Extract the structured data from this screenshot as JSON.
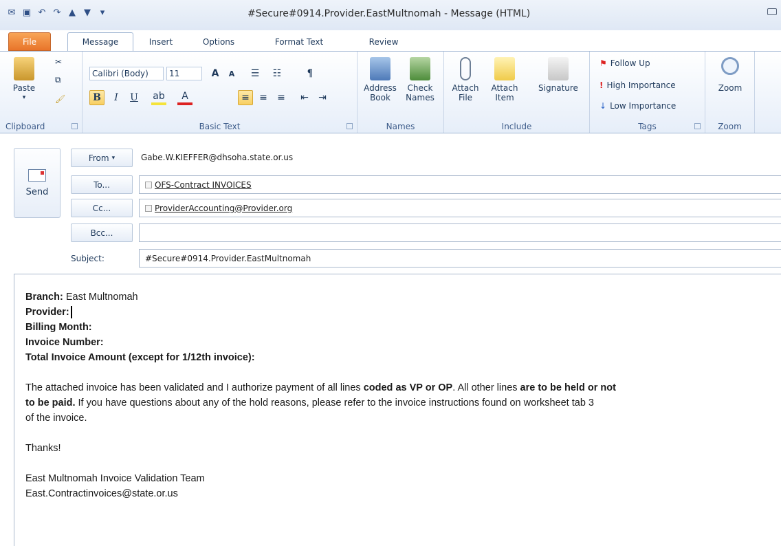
{
  "window": {
    "title": "#Secure#0914.Provider.EastMultnomah - Message (HTML)"
  },
  "tabs": [
    "File",
    "Message",
    "Insert",
    "Options",
    "Format Text",
    "Review"
  ],
  "ribbon": {
    "clipboard": {
      "label": "Clipboard",
      "paste": "Paste"
    },
    "basic_text": {
      "label": "Basic Text",
      "font_name": "Calibri (Body)",
      "font_size": "11"
    },
    "names": {
      "label": "Names",
      "address_book": "Address Book",
      "check_names": "Check Names"
    },
    "include": {
      "label": "Include",
      "attach_file": "Attach File",
      "attach_item": "Attach Item",
      "signature": "Signature"
    },
    "tags": {
      "label": "Tags",
      "follow_up": "Follow Up",
      "high_importance": "High Importance",
      "low_importance": "Low Importance"
    },
    "zoom": {
      "label": "Zoom",
      "zoom": "Zoom"
    }
  },
  "header": {
    "send": "Send",
    "from_btn": "From",
    "from_value": "Gabe.W.KIEFFER@dhsoha.state.or.us",
    "to_btn": "To...",
    "to_value": "OFS-Contract INVOICES",
    "cc_btn": "Cc...",
    "cc_value": "ProviderAccounting@Provider.org",
    "bcc_btn": "Bcc...",
    "bcc_value": "",
    "subject_label": "Subject:",
    "subject_value": "#Secure#0914.Provider.EastMultnomah"
  },
  "body": {
    "branch_label": "Branch:",
    "branch_value": "East Multnomah",
    "provider_label": "Provider:",
    "billing_label": "Billing Month:",
    "invoice_label": "Invoice Number:",
    "total_label": "Total Invoice Amount (except for 1/12th invoice):",
    "p1_a": "The attached invoice has been validated and I authorize payment of all lines ",
    "p1_b": "coded as VP or OP",
    "p1_c": ". All other lines ",
    "p1_d": "are to be held or not",
    "p1_e": "to be paid.",
    "p1_f": " If you have questions about any of the hold reasons, please refer to the invoice instructions found on worksheet tab 3",
    "p1_g": "of the invoice.",
    "thanks": "Thanks!",
    "sig1": "East Multnomah Invoice Validation Team",
    "sig2": "East.Contractinvoices@state.or.us"
  }
}
